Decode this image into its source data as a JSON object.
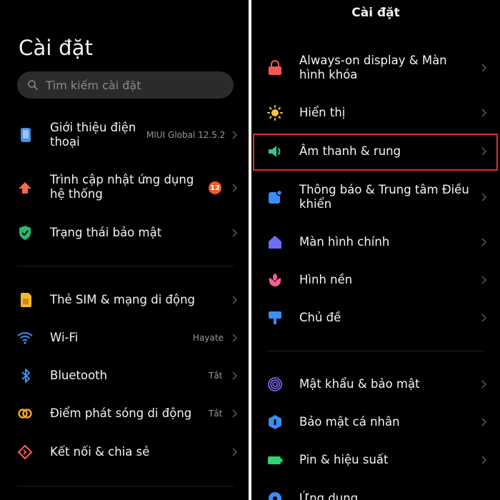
{
  "left": {
    "title": "Cài đặt",
    "search": {
      "placeholder": "Tìm kiếm cài đặt"
    },
    "items": [
      {
        "label": "Giới thiệu điện thoại",
        "value": "MIUI Global 12.5.2",
        "icon": "phone-icon",
        "color": "#4a90e2"
      },
      {
        "label": "Trình cập nhật ứng dụng hệ thống",
        "badge": "12",
        "icon": "update-arrow-icon",
        "color": "#f26b4f"
      },
      {
        "label": "Trạng thái bảo mật",
        "icon": "shield-check-icon",
        "color": "#2bb673"
      },
      {
        "label": "Thẻ SIM & mạng di động",
        "icon": "sim-icon",
        "color": "#f5b731"
      },
      {
        "label": "Wi-Fi",
        "value": "Hayate",
        "icon": "wifi-icon",
        "color": "#3a8ef6"
      },
      {
        "label": "Bluetooth",
        "value": "Tắt",
        "icon": "bluetooth-icon",
        "color": "#3a8ef6"
      },
      {
        "label": "Điểm phát sóng di động",
        "value": "Tắt",
        "icon": "hotspot-icon",
        "color": "#f5a623"
      },
      {
        "label": "Kết nối & chia sẻ",
        "icon": "share-icon",
        "color": "#f05a50"
      }
    ]
  },
  "right": {
    "title": "Cài đặt",
    "items": [
      {
        "label": "Always-on display & Màn hình khóa",
        "icon": "lock-icon",
        "color": "#f05a50"
      },
      {
        "label": "Hiển thị",
        "icon": "sun-icon",
        "color": "#f5c542"
      },
      {
        "label": "Âm thanh & rung",
        "icon": "speaker-icon",
        "color": "#3cc48a"
      },
      {
        "label": "Thông báo & Trung tâm Điều khiển",
        "icon": "notification-icon",
        "color": "#3a8ef6"
      },
      {
        "label": "Màn hình chính",
        "icon": "home-icon",
        "color": "#6c6ff5"
      },
      {
        "label": "Hình nền",
        "icon": "flower-icon",
        "color": "#f0608a"
      },
      {
        "label": "Chủ đề",
        "icon": "brush-icon",
        "color": "#3a8ef6"
      },
      {
        "label": "Mật khẩu & bảo mật",
        "icon": "fingerprint-icon",
        "color": "#8a6cf5"
      },
      {
        "label": "Bảo mật cá nhân",
        "icon": "privacy-icon",
        "color": "#3a8ef6"
      },
      {
        "label": "Pin & hiệu suất",
        "icon": "battery-icon",
        "color": "#2bd673"
      },
      {
        "label": "Ứng dụng",
        "icon": "apps-icon",
        "color": "#3a8ef6"
      }
    ]
  }
}
